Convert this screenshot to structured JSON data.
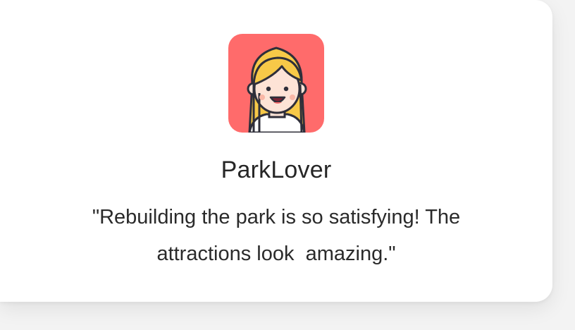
{
  "review": {
    "avatar_icon": "woman-avatar-icon",
    "avatar_bg": "#ff6b6b",
    "username": "ParkLover",
    "quote": "\"Rebuilding the park is so satisfying! The attractions look  amazing.\""
  }
}
